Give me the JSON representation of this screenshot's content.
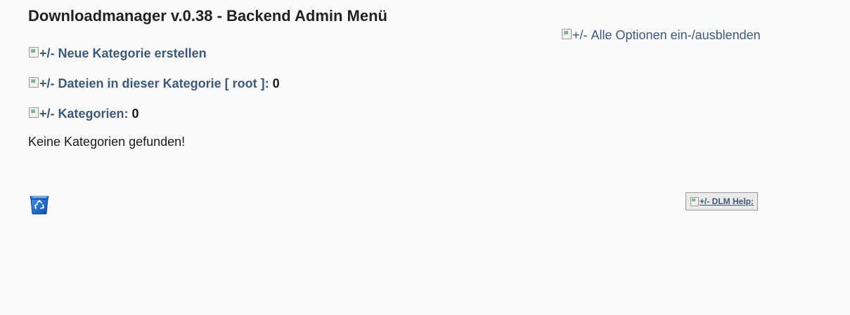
{
  "header": {
    "title": "Downloadmanager v.0.38 - Backend Admin Menü"
  },
  "toggle_all": {
    "alt": "+/-",
    "label": "Alle Optionen ein-/ausblenden"
  },
  "sections": [
    {
      "alt": "+/-",
      "label": "Neue Kategorie erstellen",
      "count": ""
    },
    {
      "alt": "+/-",
      "label_prefix": "Dateien in dieser Kategorie [",
      "category": " root ",
      "label_suffix": "]:",
      "count": "0"
    },
    {
      "alt": "+/-",
      "label": "Kategorien:",
      "count": "0"
    }
  ],
  "messages": {
    "empty": "Keine Kategorien gefunden!"
  },
  "icons": {
    "recycle_bin": "recycle-bin-icon",
    "broken_image": "broken-image-icon"
  },
  "help": {
    "alt": "+/-",
    "label": " DLM Help:"
  },
  "colors": {
    "link": "#3c5a78",
    "background": "#fafafa",
    "text": "#1a1a1a",
    "help_bg": "#e9e9e9"
  }
}
